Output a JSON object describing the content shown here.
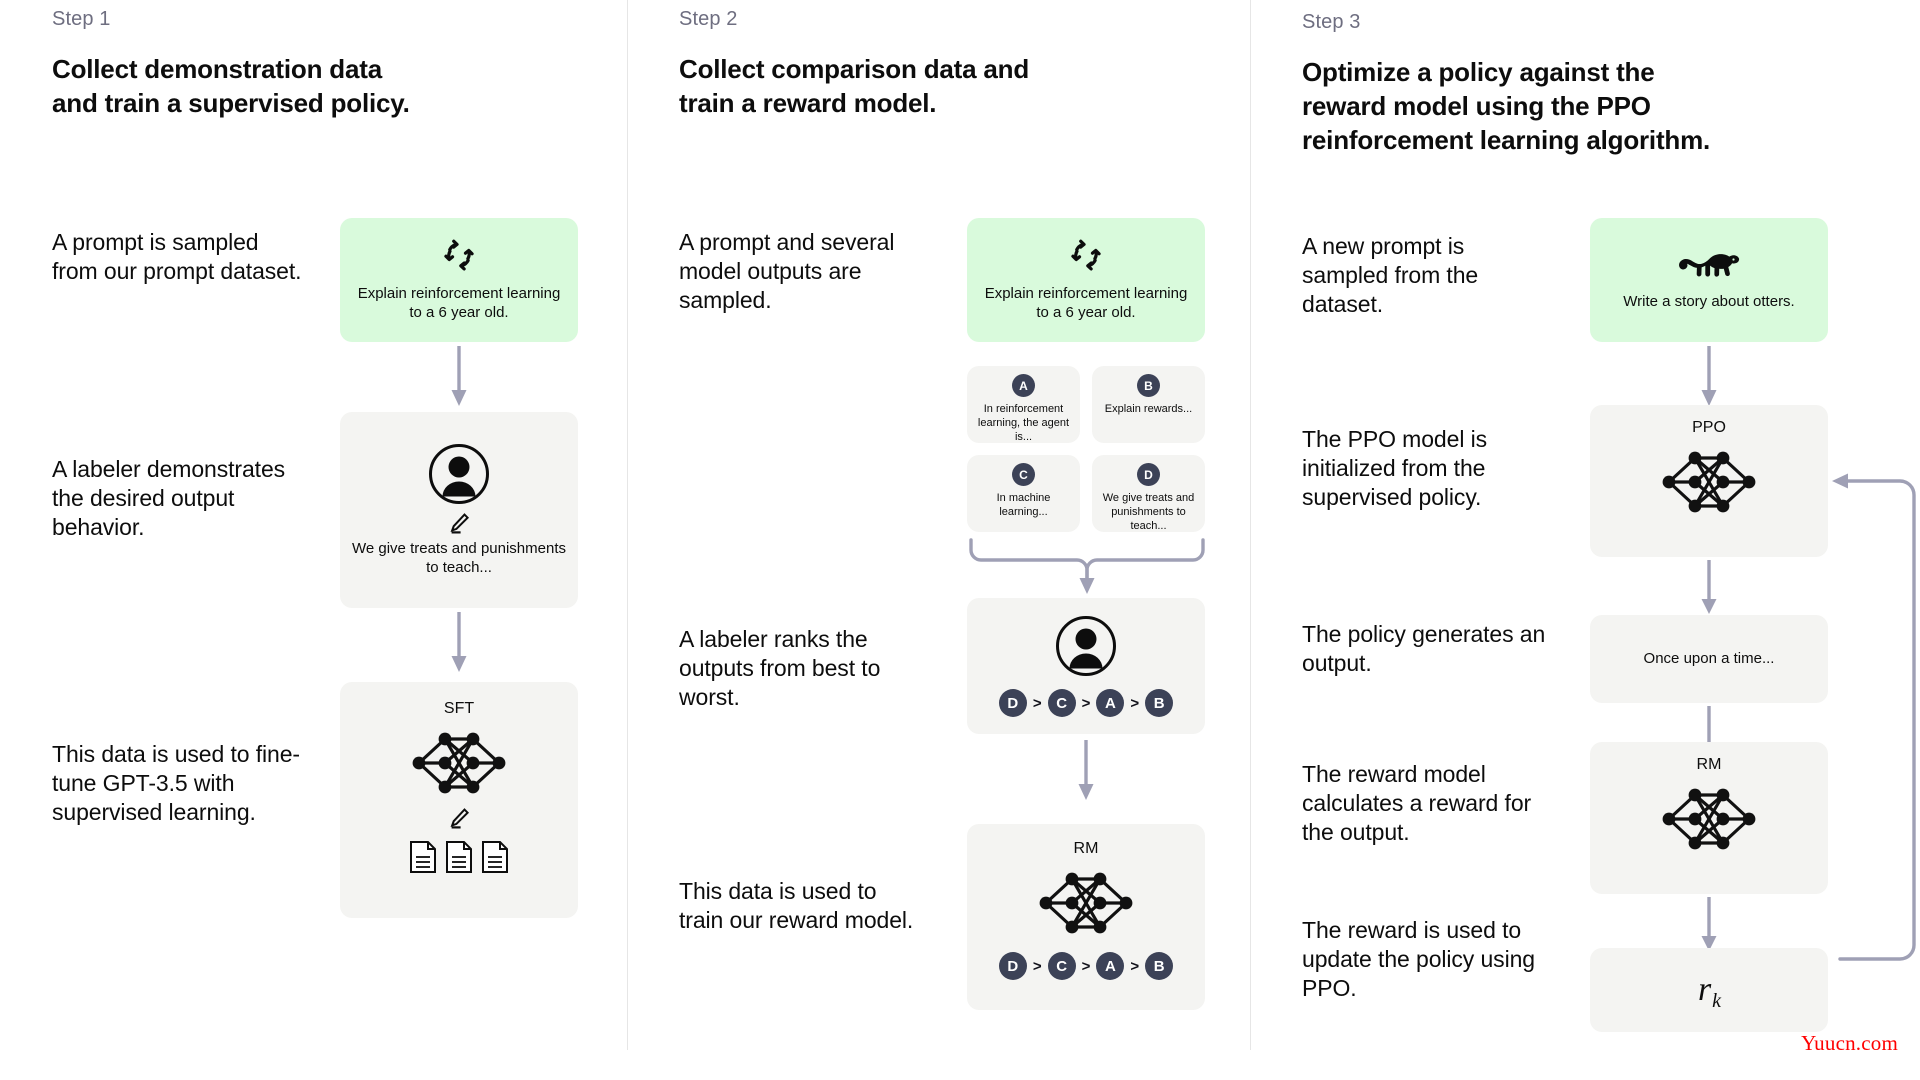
{
  "diagram": {
    "watermark": "Yuucn.com"
  },
  "colors": {
    "card_bg": "#f4f4f2",
    "card_green_bg": "#d9fadc",
    "badge_bg": "#3c4257",
    "arrow": "#9fa0b5",
    "step_label": "#6e6e80",
    "text": "#0d0d0d",
    "divider": "#e6e6e6",
    "watermark": "#ff0000"
  },
  "steps": [
    {
      "label": "Step 1",
      "title": "Collect demonstration data and train a supervised policy.",
      "title_line1": "Collect demonstration data",
      "title_line2": "and train a supervised policy.",
      "texts": [
        "A prompt is sampled from our prompt dataset.",
        "A labeler demonstrates the desired output behavior.",
        "This data is used to fine-tune GPT-3.5 with supervised learning."
      ],
      "cards": {
        "prompt": {
          "icon": "cycle-icon",
          "caption": "Explain reinforcement learning to a 6 year old."
        },
        "labeler": {
          "icon": "person-icon",
          "secondary_icon": "pencil-icon",
          "caption": "We give treats and punishments to teach..."
        },
        "model": {
          "title": "SFT",
          "icon": "neural-network-icon",
          "secondary_icon": "pencil-icon",
          "documents_icon": "documents-icon"
        }
      }
    },
    {
      "label": "Step 2",
      "title": "Collect comparison data and train a reward model.",
      "title_line1": "Collect comparison data and",
      "title_line2": "train a reward model.",
      "texts": [
        "A prompt and several model outputs are sampled.",
        "A labeler ranks the outputs from best to worst.",
        "This data is used to train our reward model."
      ],
      "cards": {
        "prompt": {
          "icon": "cycle-icon",
          "caption": "Explain reinforcement learning to a 6 year old."
        },
        "outputs": [
          {
            "badge": "A",
            "caption": "In reinforcement learning, the agent is..."
          },
          {
            "badge": "B",
            "caption": "Explain rewards..."
          },
          {
            "badge": "C",
            "caption": "In machine learning..."
          },
          {
            "badge": "D",
            "caption": "We give treats and punishments to teach..."
          }
        ],
        "labeler": {
          "icon": "person-icon",
          "ranking": [
            "D",
            "C",
            "A",
            "B"
          ],
          "separator": ">"
        },
        "model": {
          "title": "RM",
          "icon": "neural-network-icon",
          "ranking": [
            "D",
            "C",
            "A",
            "B"
          ],
          "separator": ">"
        }
      }
    },
    {
      "label": "Step 3",
      "title": "Optimize a policy against the reward model using the PPO reinforcement learning algorithm.",
      "title_line1": "Optimize a policy against the",
      "title_line2": "reward model using the PPO",
      "title_line3": "reinforcement learning algorithm.",
      "texts": [
        "A new prompt is sampled from the dataset.",
        "The PPO model is initialized from the supervised policy.",
        "The policy generates an output.",
        "The reward model calculates a reward for the output.",
        "The reward is used to update the policy using PPO."
      ],
      "cards": {
        "prompt": {
          "icon": "otter-icon",
          "caption": "Write a story about otters."
        },
        "ppo": {
          "title": "PPO",
          "icon": "neural-network-icon"
        },
        "output": {
          "caption": "Once upon a time..."
        },
        "rm": {
          "title": "RM",
          "icon": "neural-network-icon"
        },
        "reward": {
          "symbol": "r",
          "subscript": "k"
        }
      }
    }
  ]
}
